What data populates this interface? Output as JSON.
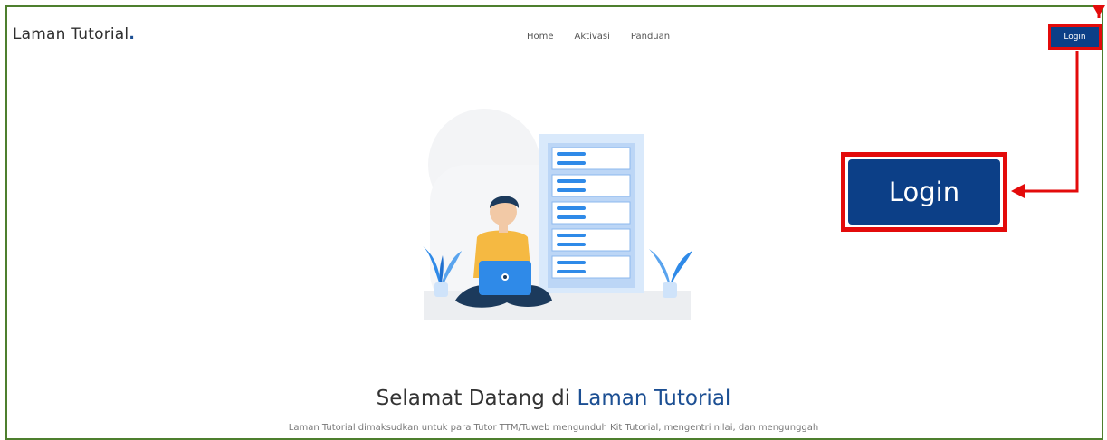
{
  "header": {
    "brand_name": "Laman Tutorial",
    "brand_dot": ".",
    "nav": [
      {
        "label": "Home"
      },
      {
        "label": "Aktivasi"
      },
      {
        "label": "Panduan"
      }
    ],
    "login_label": "Login"
  },
  "callout": {
    "login_label": "Login",
    "highlight_color": "#e30b0b",
    "button_color": "#0c3f87"
  },
  "hero": {
    "welcome_prefix": "Selamat Datang di ",
    "welcome_highlight": "Laman Tutorial",
    "description": "Laman Tutorial dimaksudkan untuk para Tutor TTM/Tuweb mengunduh Kit Tutorial, mengentri nilai, dan mengunggah"
  }
}
